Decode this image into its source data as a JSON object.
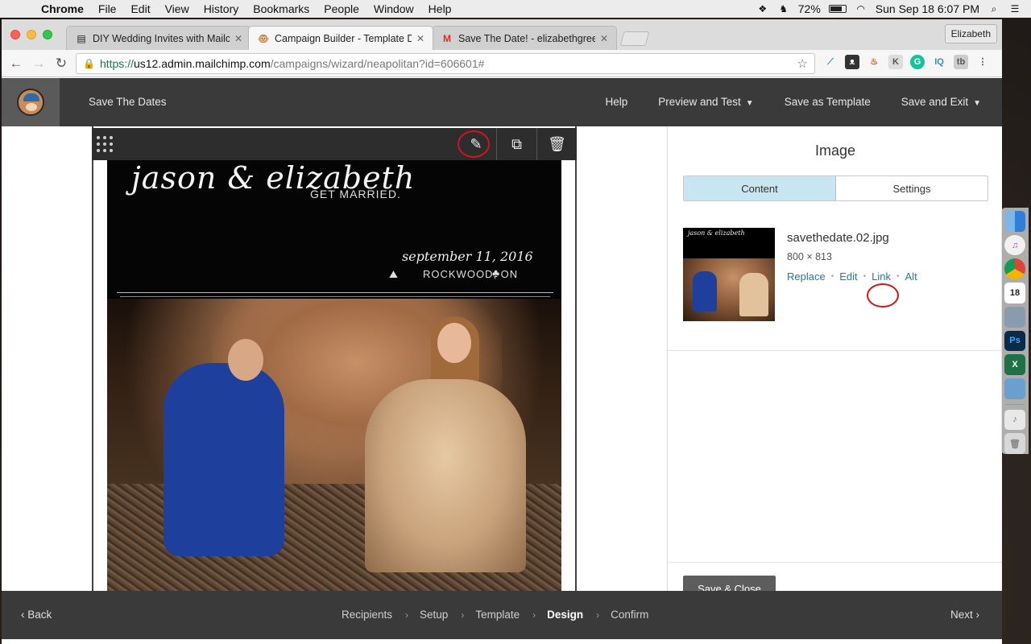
{
  "menubar": {
    "app": "Chrome",
    "menus": [
      "File",
      "Edit",
      "View",
      "History",
      "Bookmarks",
      "People",
      "Window",
      "Help"
    ],
    "battery": "72%",
    "clock": "Sun Sep 18  6:07 PM"
  },
  "browser": {
    "tabs": [
      {
        "title": "DIY Wedding Invites with Mailc",
        "icon": "document-icon"
      },
      {
        "title": "Campaign Builder - Template D",
        "icon": "mailchimp-icon"
      },
      {
        "title": "Save The Date! - elizabethgree",
        "icon": "gmail-icon"
      }
    ],
    "profile": "Elizabeth",
    "url": {
      "scheme": "https://",
      "host": "us12.admin.mailchimp.com",
      "path": "/campaigns/wizard/neapolitan?id=606601#"
    }
  },
  "header": {
    "campaign_name": "Save The Dates",
    "help": "Help",
    "preview_test": "Preview and Test",
    "save_template": "Save as Template",
    "save_exit": "Save and Exit"
  },
  "invite": {
    "names": "jason & elizabeth",
    "tagline": "GET MARRIED.",
    "date": "september 11, 2016",
    "place": "ROCKWOOD, ON"
  },
  "panel": {
    "title": "Image",
    "tabs": [
      "Content",
      "Settings"
    ],
    "active_tab": "Content",
    "file_name": "savethedate.02.jpg",
    "dimensions": "800 × 813",
    "actions": [
      "Replace",
      "Edit",
      "Link",
      "Alt"
    ],
    "thumb_title": "jason & elizabeth",
    "save_close": "Save & Close"
  },
  "footer": {
    "back": "Back",
    "next": "Next",
    "steps": [
      "Recipients",
      "Setup",
      "Template",
      "Design",
      "Confirm"
    ],
    "current_step": "Design"
  },
  "colors": {
    "header_bg": "#3a3a3a",
    "link": "#24799e",
    "active_tab": "#c8e6f2",
    "highlight_circle": "#d4141b"
  }
}
